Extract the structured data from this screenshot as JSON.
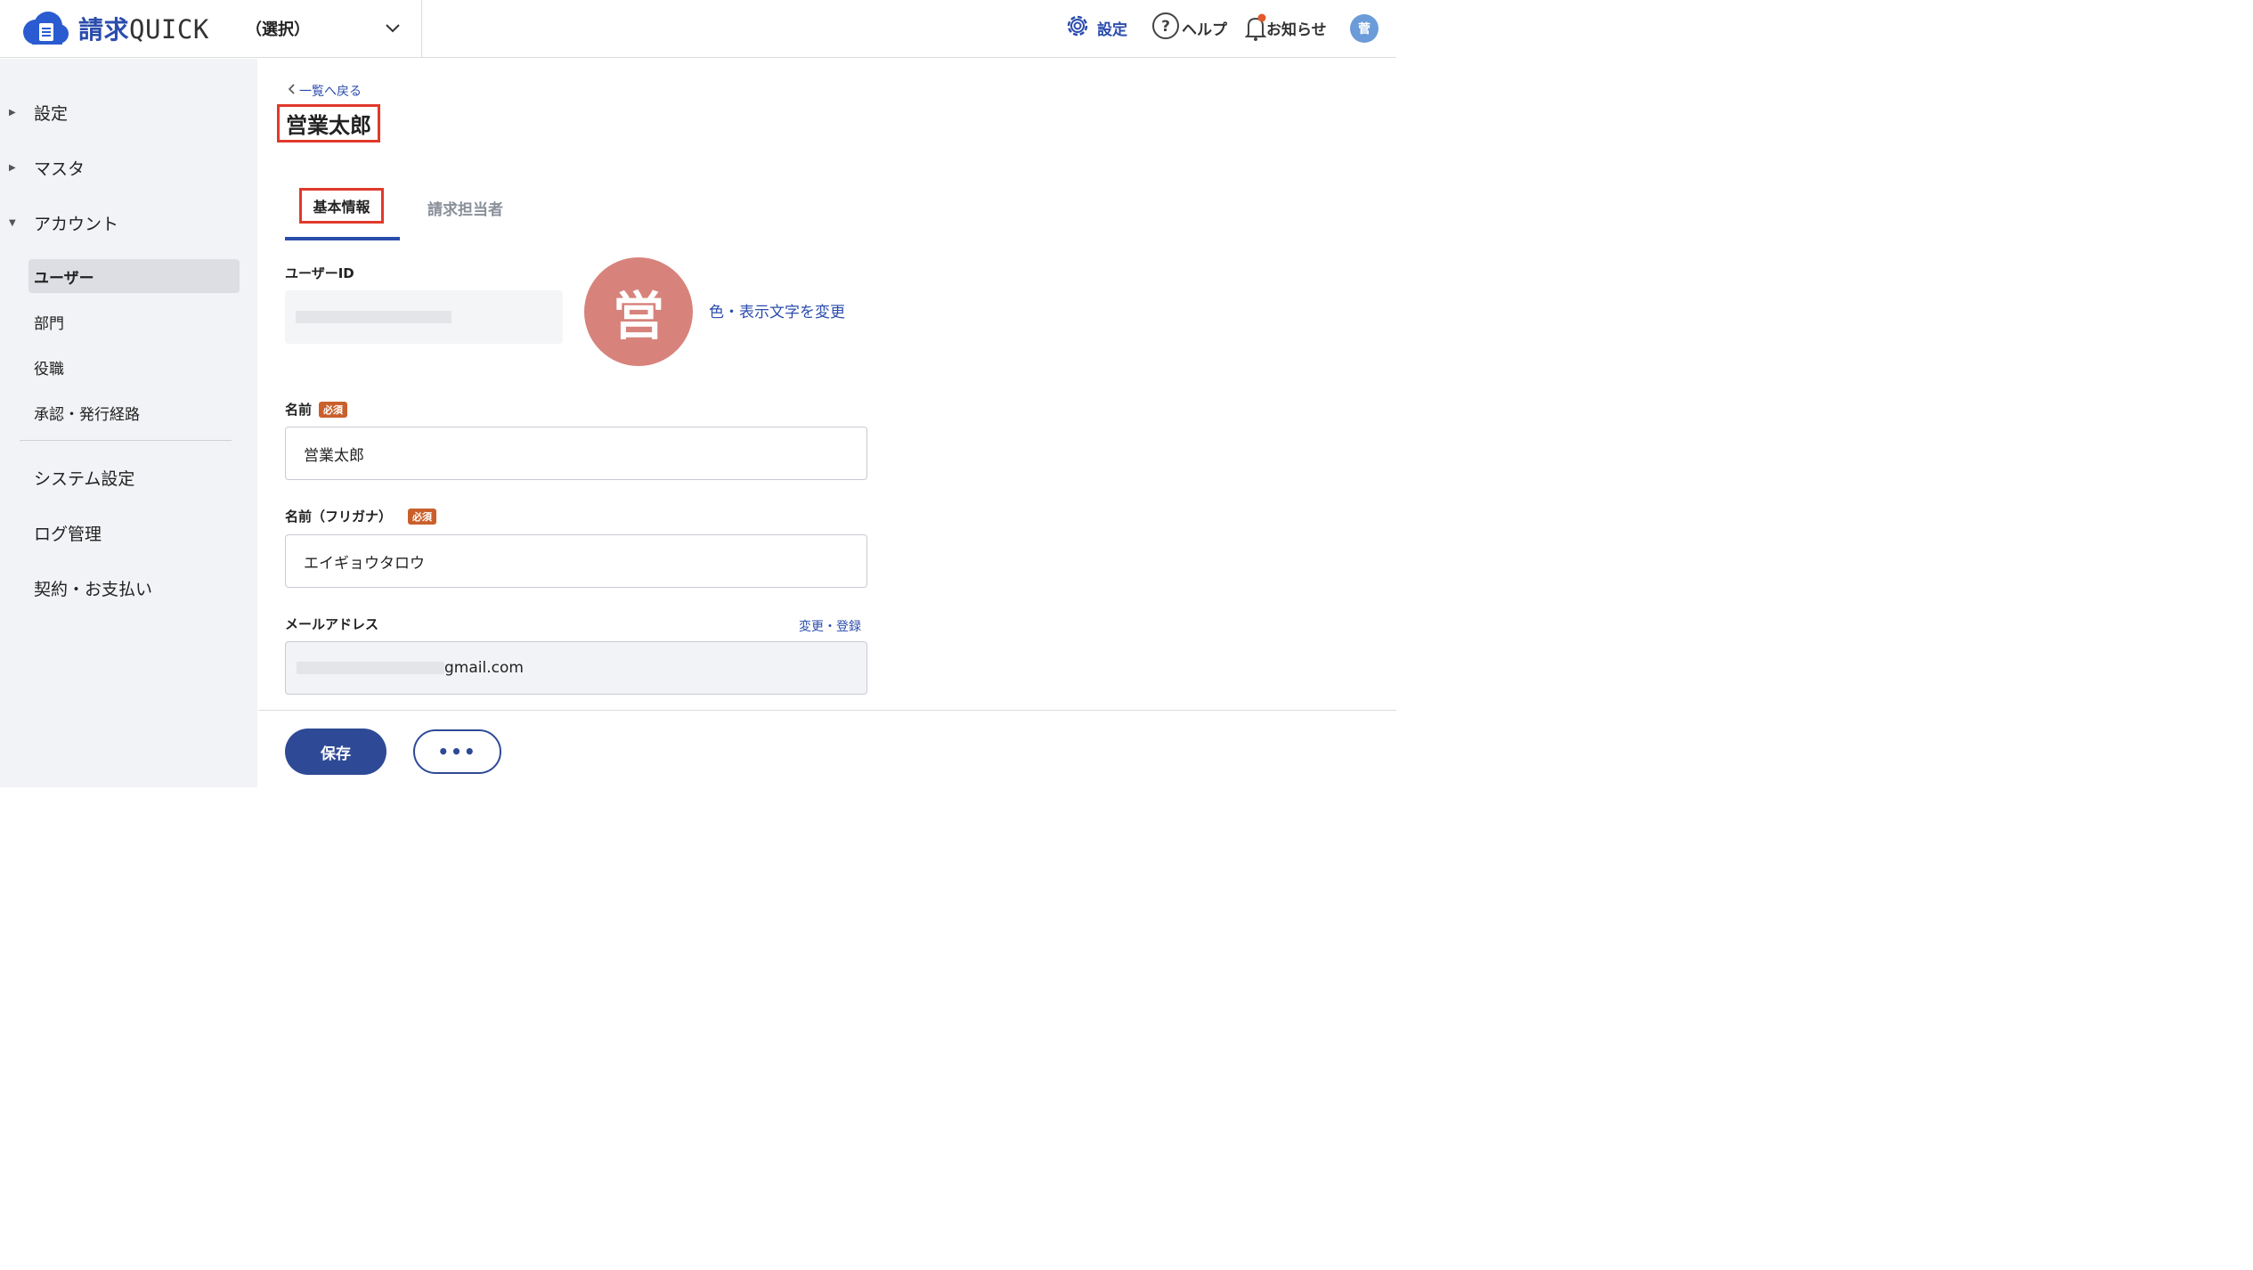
{
  "header": {
    "logo_text": "請求",
    "logo_latin": "QUICK",
    "org_select_value": "（選択）",
    "settings_label": "設定",
    "help_label": "ヘルプ",
    "notice_label": "お知らせ",
    "avatar_initial": "菅"
  },
  "sidebar": {
    "sections": [
      {
        "label": "設定",
        "expanded": false
      },
      {
        "label": "マスタ",
        "expanded": false
      },
      {
        "label": "アカウント",
        "expanded": true
      }
    ],
    "account_items": [
      {
        "label": "ユーザー",
        "active": true
      },
      {
        "label": "部門",
        "active": false
      },
      {
        "label": "役職",
        "active": false
      },
      {
        "label": "承認・発行経路",
        "active": false
      }
    ],
    "bottom_items": [
      {
        "label": "システム設定"
      },
      {
        "label": "ログ管理"
      },
      {
        "label": "契約・お支払い"
      }
    ]
  },
  "main": {
    "back_link": "一覧へ戻る",
    "page_title": "営業太郎",
    "tabs": [
      {
        "label": "基本情報",
        "active": true
      },
      {
        "label": "請求担当者",
        "active": false
      }
    ],
    "user_id_label": "ユーザーID",
    "avatar_char": "営",
    "change_color_link": "色・表示文字を変更",
    "name_label": "名前",
    "required_badge": "必須",
    "name_value": "営業太郎",
    "kana_label": "名前（フリガナ）",
    "kana_value": "エイギョウタロウ",
    "email_label": "メールアドレス",
    "email_change_link": "変更・登録",
    "email_visible_suffix": "gmail.com"
  },
  "footer": {
    "save_label": "保存",
    "more_label": "•••"
  },
  "colors": {
    "brand": "#2b4cad",
    "highlight": "#e0392b",
    "required": "#c9602c",
    "avatar_bg": "#d7837b",
    "primary_button": "#2e4a96"
  }
}
